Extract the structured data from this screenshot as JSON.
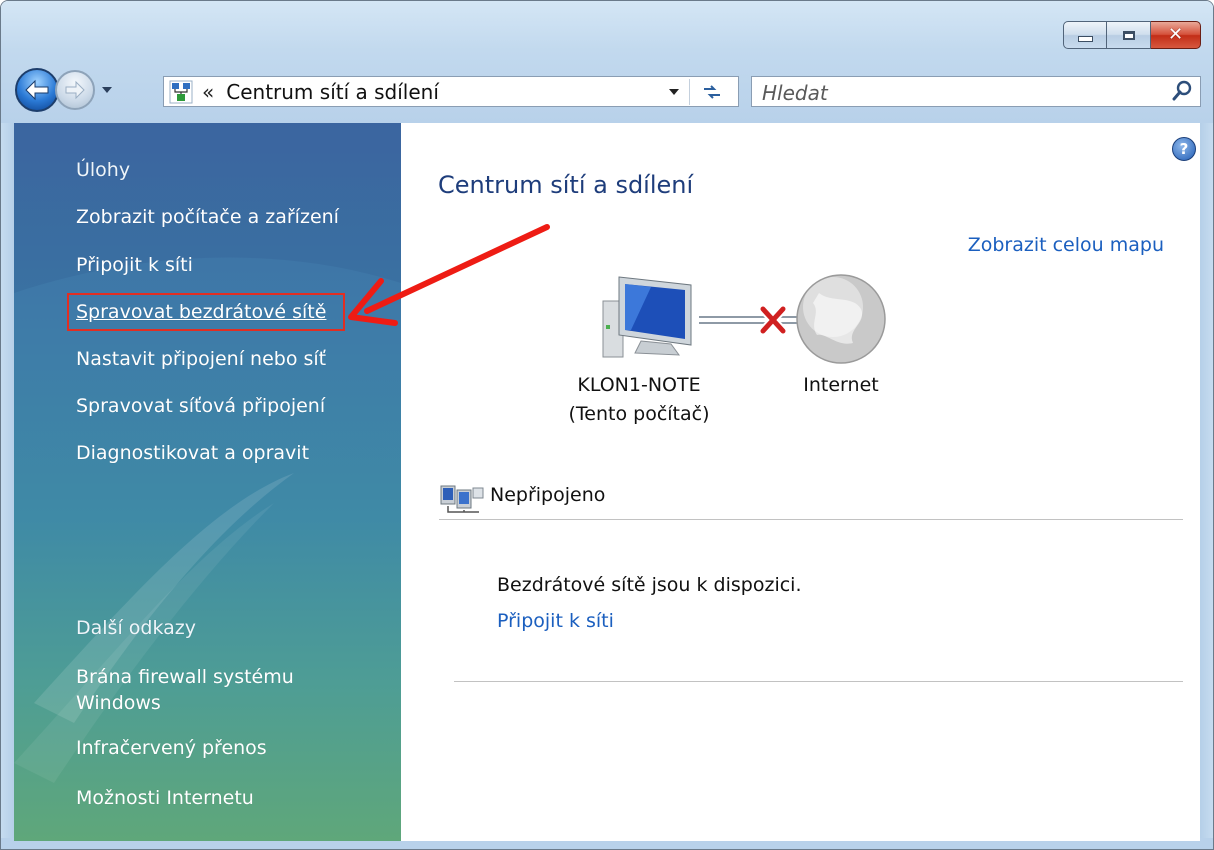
{
  "window": {
    "caption_buttons": [
      "minimize",
      "maximize",
      "close"
    ]
  },
  "navigation": {
    "back_icon": "back-arrow-icon",
    "forward_icon": "forward-arrow-icon"
  },
  "address_bar": {
    "prefix": "«",
    "location": "Centrum sítí a sdílení"
  },
  "search": {
    "placeholder": "Hledat"
  },
  "sidebar": {
    "tasks_heading": "Úlohy",
    "tasks": [
      "Zobrazit počítače a zařízení",
      "Připojit k síti",
      "Spravovat bezdrátové sítě",
      "Nastavit připojení nebo síť",
      "Spravovat síťová připojení",
      "Diagnostikovat a opravit"
    ],
    "highlighted_task": "Spravovat bezdrátové sítě",
    "other_heading": "Další odkazy",
    "other_links": [
      "Brána firewall systému Windows",
      "Infračervený přenos",
      "Možnosti Internetu"
    ]
  },
  "main": {
    "help_glyph": "?",
    "title": "Centrum sítí a sdílení",
    "view_full_map": "Zobrazit celou mapu",
    "map": {
      "computer_name": "KLON1-NOTE",
      "computer_subtitle": "(Tento počítač)",
      "internet_label": "Internet",
      "connection_state": "disconnected"
    },
    "status_label": "Nepřipojeno",
    "info_text": "Bezdrátové sítě jsou k dispozici.",
    "connect_link": "Připojit k síti"
  },
  "colors": {
    "link": "#1b5fbf",
    "title": "#1e3d7b",
    "annotation_red": "#e12e22",
    "sidebar_top": "#3f6aa5",
    "sidebar_bottom": "#5fa77a"
  }
}
